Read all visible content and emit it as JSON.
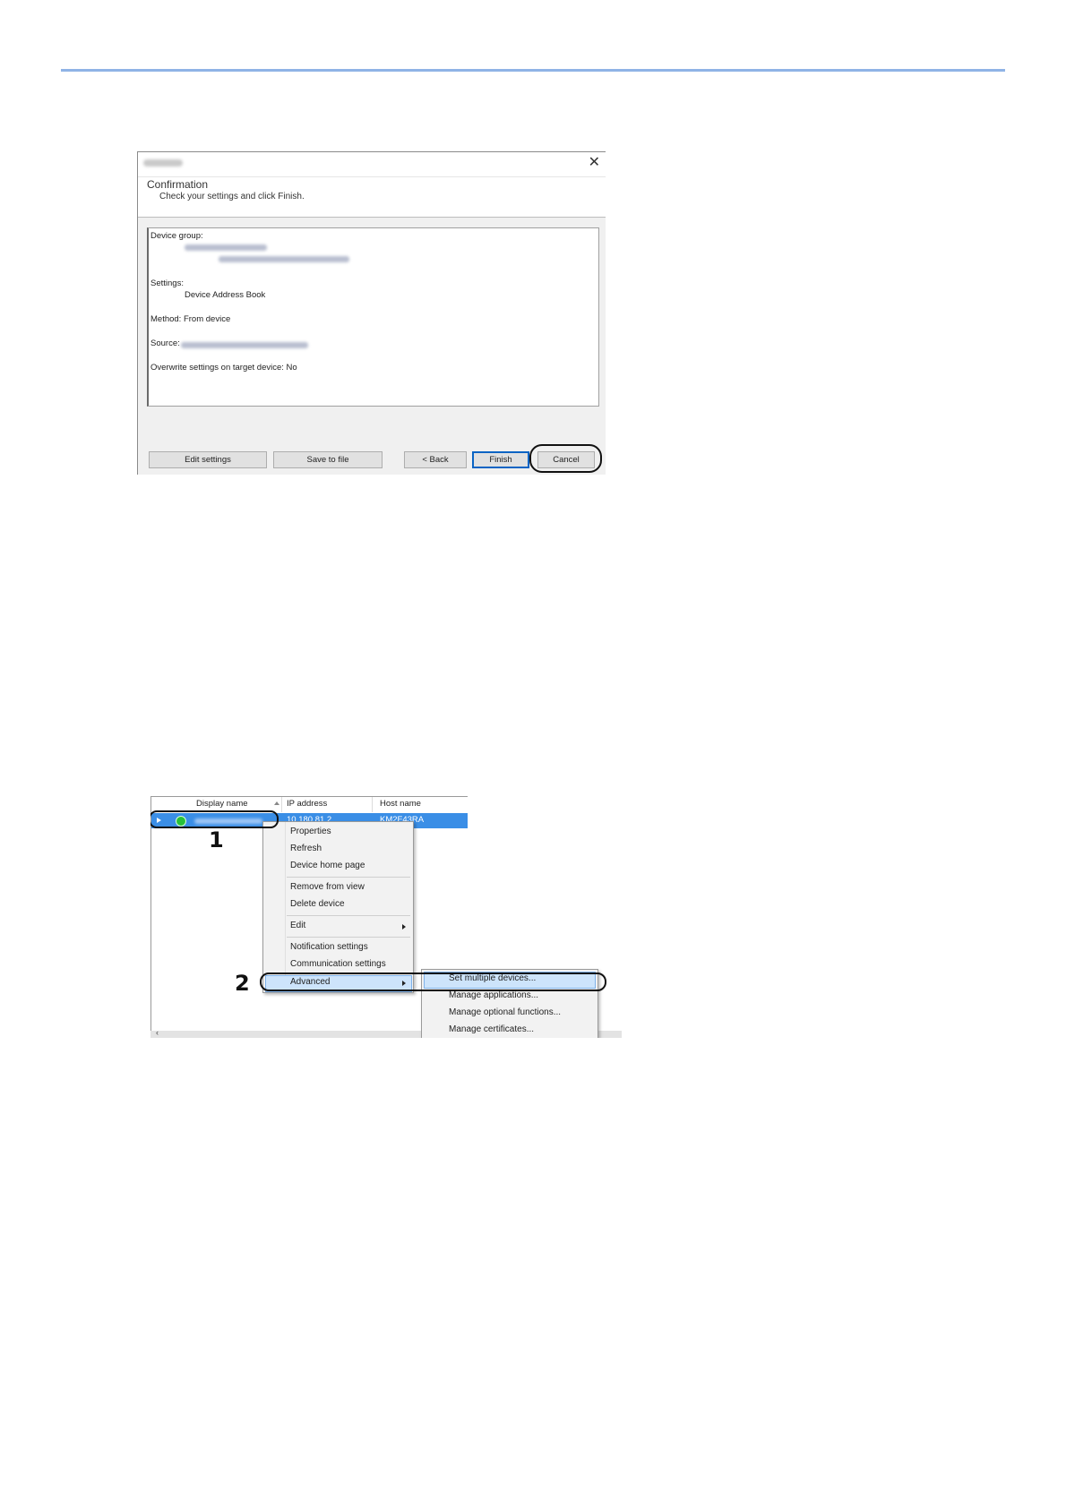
{
  "confirmation_dialog": {
    "close_glyph": "✕",
    "heading": "Confirmation",
    "subheading": "Check your settings and click Finish.",
    "summary": {
      "device_group_label": "Device group:",
      "settings_label": "Settings:",
      "settings_value": "Device Address Book",
      "method_line": "Method: From device",
      "source_label": "Source:",
      "overwrite_line": "Overwrite settings on target device: No"
    },
    "buttons": {
      "edit_settings": "Edit settings",
      "save_to_file": "Save to file",
      "back": "< Back",
      "finish": "Finish",
      "cancel": "Cancel"
    }
  },
  "device_list": {
    "columns": [
      "Display name",
      "IP address",
      "Host name"
    ],
    "selected_row": {
      "ip_address": "10.180.81.2",
      "host_name": "KM2F43RA"
    },
    "context_menu": {
      "items": [
        "Properties",
        "Refresh",
        "Device home page",
        "Remove from view",
        "Delete device",
        "Edit",
        "Notification settings",
        "Communication settings",
        "Advanced"
      ]
    },
    "advanced_submenu": {
      "items": [
        "Set multiple devices...",
        "Manage applications...",
        "Manage optional functions...",
        "Manage certificates..."
      ]
    },
    "callouts": [
      "1",
      "2"
    ]
  },
  "colors": {
    "top_rule": "#8fb3e6",
    "selection_blue": "#3a8ee6",
    "menu_highlight": "#cde4fb",
    "status_green": "#27c03a"
  }
}
